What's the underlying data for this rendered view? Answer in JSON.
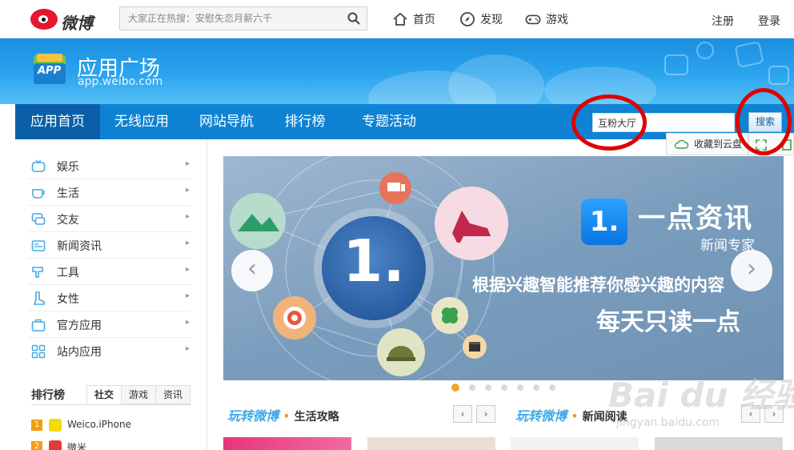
{
  "topbar": {
    "logo_text": "微博",
    "search_placeholder": "大家正在热搜：安慰失恋月薪六千",
    "nav": [
      {
        "label": "首页",
        "icon": "home-icon"
      },
      {
        "label": "发现",
        "icon": "compass-icon"
      },
      {
        "label": "游戏",
        "icon": "gamepad-icon"
      }
    ],
    "register": "注册",
    "login": "登录"
  },
  "banner": {
    "badge": "APP",
    "title": "应用广场",
    "subtitle": "app.weibo.com"
  },
  "navbar": {
    "tabs": [
      "应用首页",
      "无线应用",
      "网站导航",
      "排行榜",
      "专题活动"
    ],
    "active_tab": "应用首页",
    "search_value": "互粉大厅",
    "search_button": "搜索",
    "cloud_save": "收藏到云盘"
  },
  "sidebar": {
    "categories": [
      {
        "label": "娱乐",
        "icon": "tv-icon"
      },
      {
        "label": "生活",
        "icon": "cup-icon"
      },
      {
        "label": "交友",
        "icon": "chat-icon"
      },
      {
        "label": "新闻资讯",
        "icon": "news-icon"
      },
      {
        "label": "工具",
        "icon": "tool-icon"
      },
      {
        "label": "女性",
        "icon": "boot-icon"
      },
      {
        "label": "官方应用",
        "icon": "briefcase-icon"
      },
      {
        "label": "站内应用",
        "icon": "grid-icon"
      }
    ],
    "ranking": {
      "title": "排行榜",
      "tabs": [
        "社交",
        "游戏",
        "资讯"
      ],
      "active_tab": "社交",
      "items": [
        {
          "rank": "1",
          "name": "Weico.iPhone"
        },
        {
          "rank": "2",
          "name": "微米"
        }
      ]
    }
  },
  "carousel": {
    "badge": "1.",
    "globe_text": "1.",
    "brand": "一点资讯",
    "tagline": "新闻专家",
    "line1": "根据兴趣智能推荐你感兴趣的内容",
    "line2": "每天只读一点",
    "prev": "‹",
    "next": "›",
    "slide_count": 7,
    "active_slide": 1
  },
  "sections": [
    {
      "em": "玩转微博",
      "sep": "•",
      "title": "生活攻略"
    },
    {
      "em": "玩转微博",
      "sep": "•",
      "title": "新闻阅读"
    }
  ],
  "watermark": {
    "main": "Bai du 经验",
    "sub": "jingyan.baidu.com"
  },
  "colors": {
    "brand_blue": "#0f82d4",
    "nav_active": "#0a5fa8",
    "annotation_red": "#e00000"
  }
}
